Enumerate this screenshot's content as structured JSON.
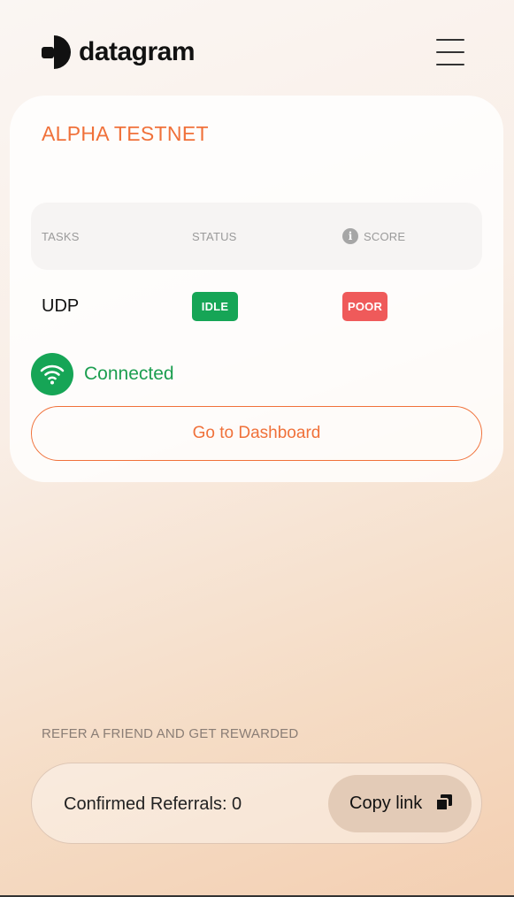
{
  "header": {
    "brand": "datagram",
    "menu_icon": "hamburger-menu-icon"
  },
  "card": {
    "title": "ALPHA TESTNET",
    "table": {
      "headers": [
        "TASKS",
        "STATUS",
        "SCORE"
      ],
      "score_info_icon": "i",
      "rows": [
        {
          "task": "UDP",
          "status": "IDLE",
          "score": "POOR"
        }
      ]
    },
    "connection": {
      "icon": "wifi-icon",
      "label": "Connected"
    },
    "dashboard_button": "Go to Dashboard"
  },
  "referral": {
    "heading": "REFER A FRIEND AND GET REWARDED",
    "confirmed_label": "Confirmed Referrals: 0",
    "copy_button": "Copy link",
    "copy_icon": "copy-icon"
  },
  "colors": {
    "accent": "#f0713a",
    "success": "#16a556",
    "danger": "#ef5a5a"
  }
}
